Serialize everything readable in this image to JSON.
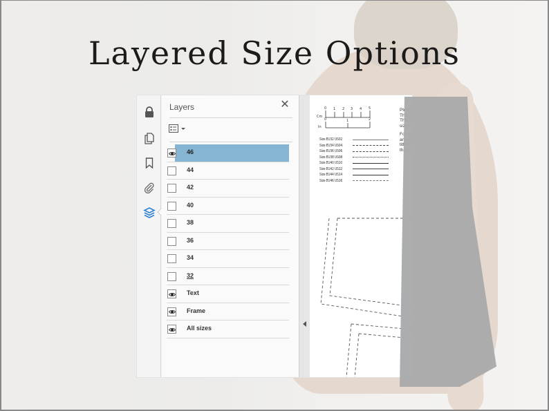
{
  "headline": "Layered Size Options",
  "colors": {
    "selection": "#86b5d3",
    "active_icon": "#2d7fd3"
  },
  "rail": {
    "items": [
      {
        "icon": "lock-icon",
        "label": "Security"
      },
      {
        "icon": "pages-icon",
        "label": "Page Thumbnails"
      },
      {
        "icon": "bookmark-icon",
        "label": "Bookmarks"
      },
      {
        "icon": "paperclip-icon",
        "label": "Attachments"
      },
      {
        "icon": "layers-icon",
        "label": "Layers",
        "active": true
      }
    ]
  },
  "layers_panel": {
    "title": "Layers",
    "close_icon": "close-icon",
    "options_icon": "layer-options-icon",
    "layers": [
      {
        "name": "46",
        "visible": true,
        "selected": true
      },
      {
        "name": "44",
        "visible": false
      },
      {
        "name": "42",
        "visible": false
      },
      {
        "name": "40",
        "visible": false
      },
      {
        "name": "38",
        "visible": false
      },
      {
        "name": "36",
        "visible": false
      },
      {
        "name": "34",
        "visible": false
      },
      {
        "name": "32",
        "visible": false,
        "underlined": true
      },
      {
        "name": "Text",
        "visible": true
      },
      {
        "name": "Frame",
        "visible": true
      },
      {
        "name": "All sizes",
        "visible": true
      }
    ]
  },
  "document": {
    "ruler_cm": {
      "label": "Cm",
      "ticks": [
        "0",
        "1",
        "2",
        "3",
        "4",
        "5"
      ]
    },
    "ruler_in": {
      "label": "In",
      "ticks": [
        "0",
        "1",
        "2"
      ]
    },
    "size_legend": [
      {
        "label": "Size EU32 US02",
        "style": "solid-thin"
      },
      {
        "label": "Size EU34 US04",
        "style": "long-dash"
      },
      {
        "label": "Size EU36 US06",
        "style": "dash-dot"
      },
      {
        "label": "Size EU38 US08",
        "style": "dash-dot-dot"
      },
      {
        "label": "Size EU40 US10",
        "style": "solid"
      },
      {
        "label": "Size EU42 US12",
        "style": "solid-gap"
      },
      {
        "label": "Size EU44 US14",
        "style": "solid-dotted"
      },
      {
        "label": "Size EU46 US16",
        "style": "dashed"
      }
    ],
    "notes": [
      [
        "Please",
        "This p",
        "This a",
        "sizes"
      ],
      [
        "For in",
        "and a",
        "titled",
        "that's"
      ]
    ]
  }
}
